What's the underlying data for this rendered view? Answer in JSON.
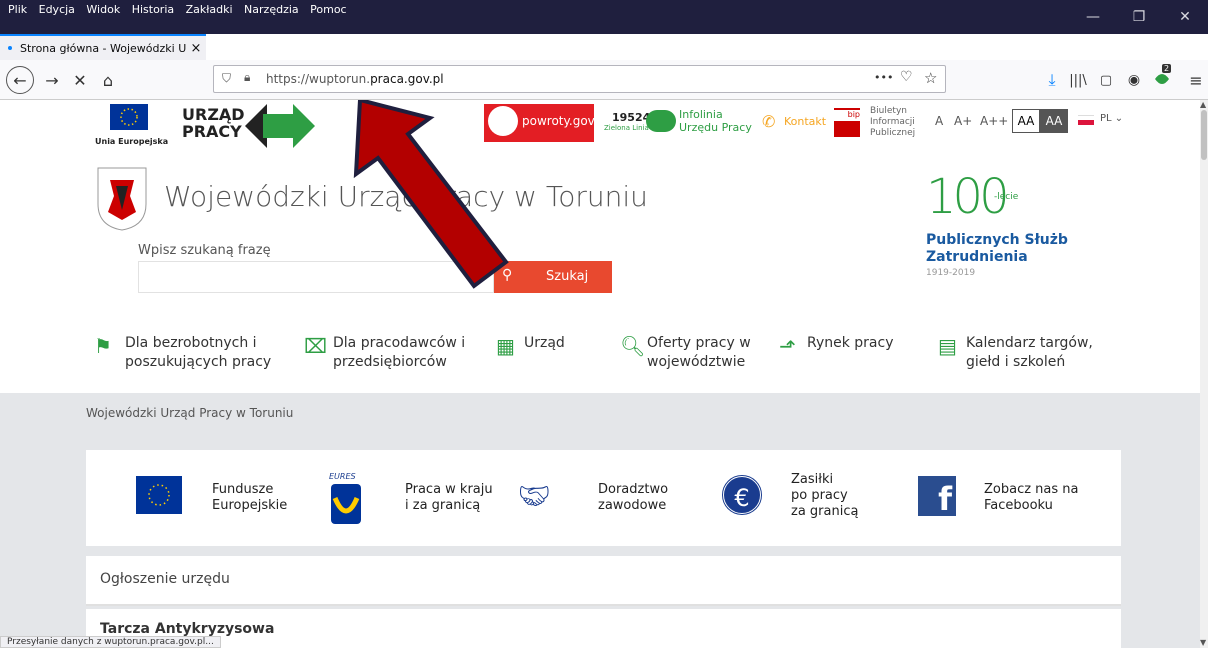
{
  "menu": [
    "Plik",
    "Edycja",
    "Widok",
    "Historia",
    "Zakładki",
    "Narzędzia",
    "Pomoc"
  ],
  "tab": {
    "title": "Strona główna - Wojewódzki U",
    "close": "×"
  },
  "newtab": "+",
  "url": {
    "prefix": "https://wuptorun.",
    "domain": "praca.gov.pl"
  },
  "toolbar": {
    "back": "←",
    "forward": "→",
    "stop": "✕",
    "home": "⌂",
    "more": "•••",
    "download_badge": "2"
  },
  "header": {
    "ue": "Unia Europejska",
    "urzad_line1": "URZĄD",
    "urzad_line2": "PRACY",
    "powroty": "powroty.gov.pl",
    "zielona_num": "19524",
    "zielona_txt": "Zielona Linia",
    "infolinia_1": "Infolinia",
    "infolinia_2": "Urzędu Pracy",
    "kontakt": "Kontakt",
    "bip": "bip",
    "bip_1": "Biuletyn",
    "bip_2": "Informacji",
    "bip_3": "Publicznej",
    "font_a": "A",
    "font_a1": "A+",
    "font_a2": "A++",
    "contrast_1": "AA",
    "contrast_2": "AA",
    "lang": "PL"
  },
  "title": "Wojewódzki Urząd Pracy w Toruniu",
  "search": {
    "label": "Wpisz szukaną frazę",
    "button": "Szukaj"
  },
  "anniversary": {
    "big": "100",
    "small": "-lecie",
    "line1": "Publicznych Służb",
    "line2": "Zatrudnienia",
    "years": "1919-2019"
  },
  "nav": [
    {
      "l1": "Dla bezrobotnych i",
      "l2": "poszukujących pracy"
    },
    {
      "l1": "Dla pracodawców i",
      "l2": "przedsiębiorców"
    },
    {
      "l1": "Urząd",
      "l2": ""
    },
    {
      "l1": "Oferty pracy w",
      "l2": "województwie"
    },
    {
      "l1": "Rynek pracy",
      "l2": ""
    },
    {
      "l1": "Kalendarz targów,",
      "l2": "giełd i szkoleń"
    }
  ],
  "breadcrumb": "Wojewódzki Urząd Pracy w Toruniu",
  "tiles": [
    {
      "l1": "Fundusze",
      "l2": "Europejskie",
      "l3": ""
    },
    {
      "l1": "Praca w kraju",
      "l2": "i za granicą",
      "l3": ""
    },
    {
      "l1": "Doradztwo",
      "l2": "zawodowe",
      "l3": ""
    },
    {
      "l1": "Zasiłki",
      "l2": "po pracy",
      "l3": "za granicą"
    },
    {
      "l1": "Zobacz nas na",
      "l2": "Facebooku",
      "l3": ""
    }
  ],
  "eures": "EURES",
  "announcement": "Ogłoszenie urzędu",
  "announcement2": "Tarcza Antykryzysowa",
  "status": "Przesyłanie danych z wuptorun.praca.gov.pl...",
  "colors": {
    "green": "#2e9e44",
    "red_button": "#e8492f",
    "arrow": "#b30000",
    "dark_blue": "#1f1f3e"
  }
}
